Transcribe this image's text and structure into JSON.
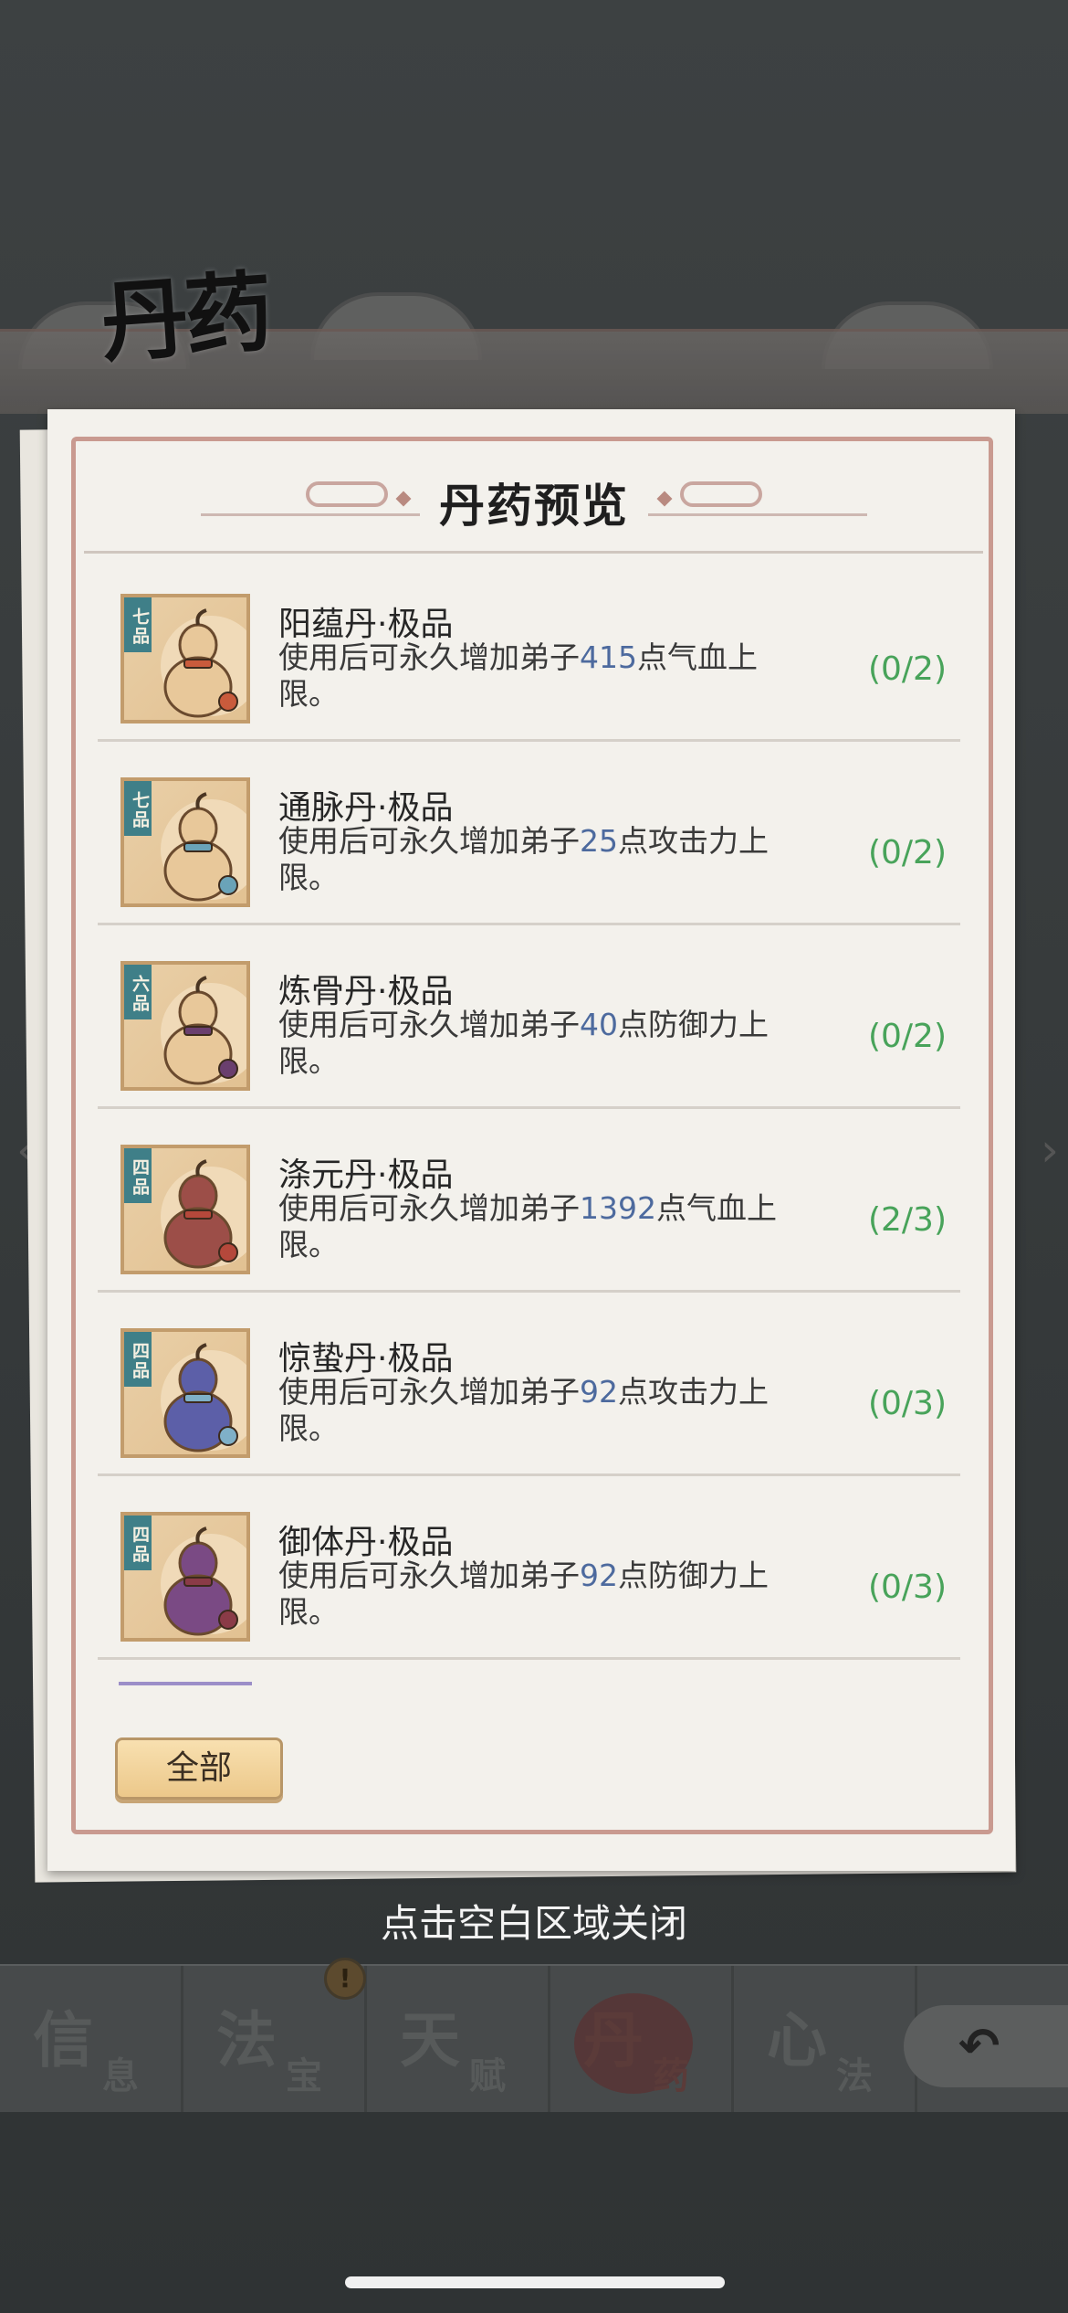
{
  "background_page": {
    "title": "丹药",
    "tabs": [
      {
        "big": "信",
        "small": "息"
      },
      {
        "big": "法",
        "small": "宝"
      },
      {
        "big": "天",
        "small": "赋"
      },
      {
        "big": "丹",
        "small": "药"
      },
      {
        "big": "心",
        "small": "法"
      }
    ],
    "alert_badge": "!"
  },
  "dialog": {
    "title": "丹药预览",
    "items": [
      {
        "grade": "七品",
        "name": "阳蕴丹·极品",
        "desc_prefix": "使用后可永久增加弟子",
        "value": "415",
        "desc_suffix": "点气血上限。",
        "count": "(0/2)",
        "color": "#e8c89a",
        "accent": "#c95b3c"
      },
      {
        "grade": "七品",
        "name": "通脉丹·极品",
        "desc_prefix": "使用后可永久增加弟子",
        "value": "25",
        "desc_suffix": "点攻击力上限。",
        "count": "(0/2)",
        "color": "#e8c89a",
        "accent": "#6aa3b8"
      },
      {
        "grade": "六品",
        "name": "炼骨丹·极品",
        "desc_prefix": "使用后可永久增加弟子",
        "value": "40",
        "desc_suffix": "点防御力上限。",
        "count": "(0/2)",
        "color": "#e8c89a",
        "accent": "#6a3f6e"
      },
      {
        "grade": "四品",
        "name": "涤元丹·极品",
        "desc_prefix": "使用后可永久增加弟子",
        "value": "1392",
        "desc_suffix": "点气血上限。",
        "count": "(2/3)",
        "color": "#9c4e48",
        "accent": "#b5483b"
      },
      {
        "grade": "四品",
        "name": "惊蛰丹·极品",
        "desc_prefix": "使用后可永久增加弟子",
        "value": "92",
        "desc_suffix": "点攻击力上限。",
        "count": "(0/3)",
        "color": "#5c5fa8",
        "accent": "#7fb0c8"
      },
      {
        "grade": "四品",
        "name": "御体丹·极品",
        "desc_prefix": "使用后可永久增加弟子",
        "value": "92",
        "desc_suffix": "点防御力上限。",
        "count": "(0/3)",
        "color": "#7a4a84",
        "accent": "#8a3b47"
      }
    ],
    "filter_button": "全部"
  },
  "close_hint": "点击空白区域关闭"
}
